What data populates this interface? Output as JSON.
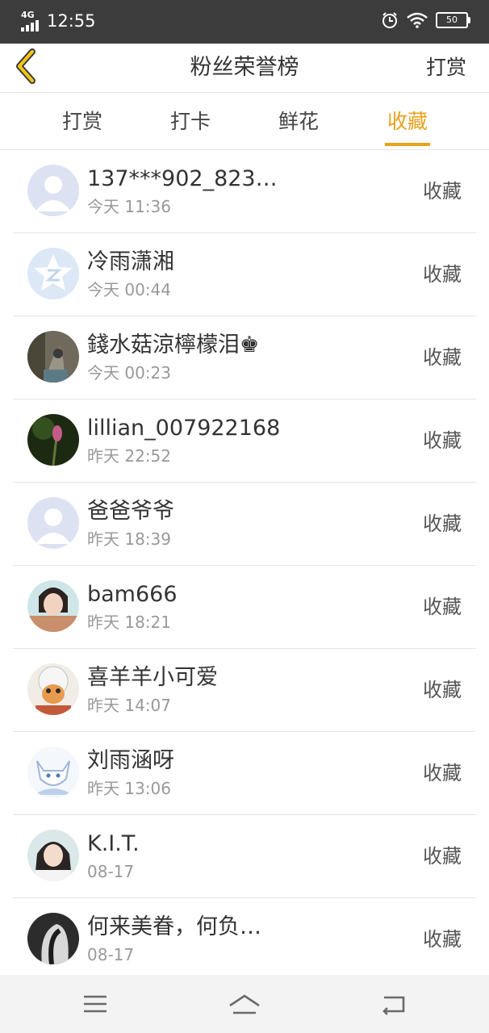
{
  "status_bar": {
    "network": "4G",
    "time": "12:55",
    "battery": "50",
    "icons": [
      "signal-icon",
      "alarm-icon",
      "wifi-icon",
      "battery-icon"
    ]
  },
  "header": {
    "title": "粉丝荣誉榜",
    "right_action": "打赏",
    "back_icon": "chevron-left-icon",
    "accent_color": "#e8a21c"
  },
  "tabs": [
    {
      "label": "打赏"
    },
    {
      "label": "打卡"
    },
    {
      "label": "鲜花"
    },
    {
      "label": "收藏"
    }
  ],
  "active_tab": "收藏",
  "list": [
    {
      "name": "137***902_823…",
      "time": "今天 11:36",
      "action": "收藏"
    },
    {
      "name": "冷雨潇湘",
      "time": "今天 00:44",
      "action": "收藏"
    },
    {
      "name": "錢水菇涼檸檬泪♚",
      "time": "今天 00:23",
      "action": "收藏"
    },
    {
      "name": "lillian_007922168",
      "time": "昨天 22:52",
      "action": "收藏"
    },
    {
      "name": "爸爸爷爷",
      "time": "昨天 18:39",
      "action": "收藏"
    },
    {
      "name": "bam666",
      "time": "昨天 18:21",
      "action": "收藏"
    },
    {
      "name": "喜羊羊小可爱",
      "time": "昨天 14:07",
      "action": "收藏"
    },
    {
      "name": "刘雨涵呀",
      "time": "昨天 13:06",
      "action": "收藏"
    },
    {
      "name": "K.I.T.",
      "time": "08-17",
      "action": "收藏"
    },
    {
      "name": "何来美眷，何负…",
      "time": "08-17",
      "action": "收藏"
    }
  ],
  "nav_bar": {
    "buttons": [
      "menu-icon",
      "home-icon",
      "back-icon"
    ]
  }
}
